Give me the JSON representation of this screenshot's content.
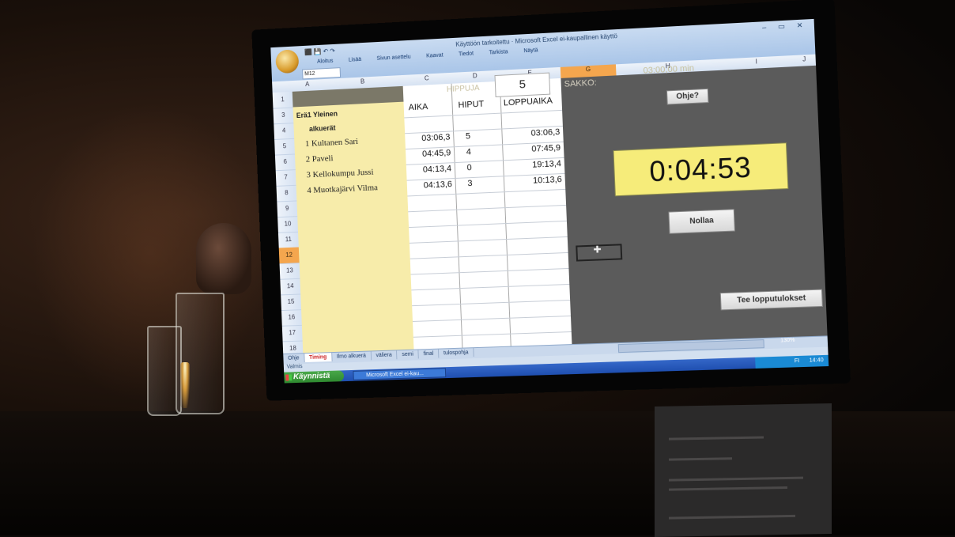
{
  "window": {
    "title": "Käyttöön tarkoitettu · Microsoft Excel ei-kaupallinen käyttö",
    "qat": "⬛ 💾 ↶ ↷",
    "controls": "– ▭ ✕"
  },
  "ribbon": {
    "tabs": [
      "Aloitus",
      "Lisää",
      "Sivun asettelu",
      "Kaavat",
      "Tiedot",
      "Tarkista",
      "Näytä"
    ],
    "name_box": "M12"
  },
  "columns": [
    "A",
    "B",
    "C",
    "D",
    "E",
    "G",
    "H",
    "I",
    "J"
  ],
  "selected_column": "G",
  "rows": [
    "1",
    "3",
    "4",
    "5",
    "6",
    "7",
    "8",
    "9",
    "10",
    "11",
    "12",
    "13",
    "14",
    "15",
    "16",
    "17",
    "18"
  ],
  "selected_row": "12",
  "sheet": {
    "hipput_label": "HIPPUJA",
    "hipput_value": "5",
    "sakko_label": "SAKKO:",
    "sakko_time": "03:00,00 min",
    "heat_title": "Erä1 Yleinen",
    "heat_subtitle": "alkuerät",
    "headers": {
      "aika": "AIKA",
      "hiput": "HIPUT",
      "loppuaika": "LOPPUAIKA"
    },
    "competitors": [
      {
        "name": "1 Kultanen Sari",
        "aika": "03:06,3",
        "hiput": "5",
        "loppuaika": "03:06,3"
      },
      {
        "name": "2 Paveli",
        "aika": "04:45,9",
        "hiput": "4",
        "loppuaika": "07:45,9"
      },
      {
        "name": "3 Kellokumpu Jussi",
        "aika": "04:13,4",
        "hiput": "0",
        "loppuaika": "19:13,4"
      },
      {
        "name": "4 Muotkajärvi Vilma",
        "aika": "04:13,6",
        "hiput": "3",
        "loppuaika": "10:13,6"
      }
    ],
    "help_button": "Ohje?",
    "timer": "0:04:53",
    "reset_button": "Nollaa",
    "results_button": "Tee lopputulokset"
  },
  "sheet_tabs": [
    "Ohje",
    "Timing",
    "Ilmo alkuerä",
    "väliera",
    "semi",
    "final",
    "tulospohja"
  ],
  "active_tab": "Timing",
  "status": {
    "left": "Valmis",
    "zoom": "130%"
  },
  "taskbar": {
    "start": "Käynnistä",
    "task": "Microsoft Excel ei-kau...",
    "lang": "FI",
    "clock": "14:40"
  }
}
